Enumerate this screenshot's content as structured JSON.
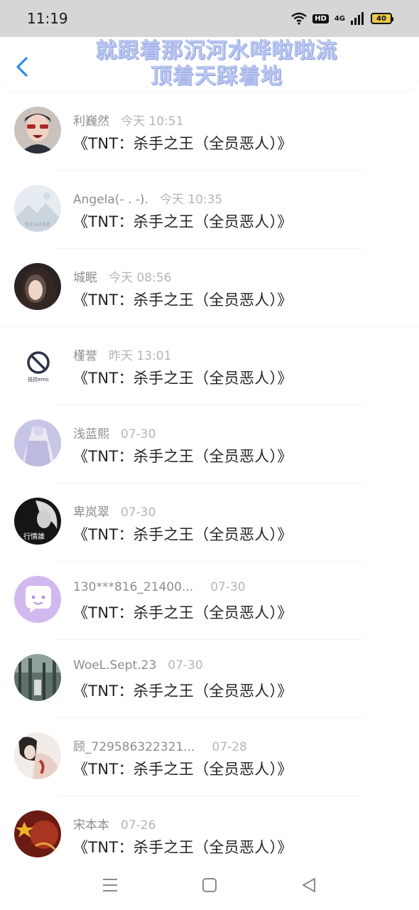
{
  "status_bar": {
    "time": "11:19",
    "hd": "HD",
    "network": "4G",
    "battery": "40",
    "icons": [
      "wifi-icon",
      "hd-icon",
      "signal-icon",
      "battery-icon"
    ]
  },
  "header": {
    "back_icon": "chevron-left-icon",
    "title_line1": "就跟着那沉河水哗啦啦流",
    "title_line2": "顶着天踩着地",
    "accent": "#2f8be6"
  },
  "messages": [
    {
      "name": "利巍然",
      "time": "今天 10:51",
      "text": "《TNT：杀手之王（全员恶人）》"
    },
    {
      "name": "Angela(- . -).",
      "time": "今天 10:35",
      "text": "《TNT：杀手之王（全员恶人）》"
    },
    {
      "name": "城眠",
      "time": "今天 08:56",
      "text": "《TNT：杀手之王（全员恶人）》"
    },
    {
      "name": "槿誉",
      "time": "昨天 13:01",
      "text": "《TNT：杀手之王（全员恶人）》"
    },
    {
      "name": "浅蓝熙",
      "time": "07-30",
      "text": "《TNT：杀手之王（全员恶人）》"
    },
    {
      "name": "卑岚翠",
      "time": "07-30",
      "text": "《TNT：杀手之王（全员恶人）》"
    },
    {
      "name": "130***816_21400...",
      "time": "07-30",
      "text": "《TNT：杀手之王（全员恶人）》"
    },
    {
      "name": "WoeL.Sept.23",
      "time": "07-30",
      "text": "《TNT：杀手之王（全员恶人）》"
    },
    {
      "name": "顾_729586322321...",
      "time": "07-28",
      "text": "《TNT：杀手之王（全员恶人）》"
    },
    {
      "name": "宋本本",
      "time": "07-26",
      "text": "《TNT：杀手之王（全员恶人）》"
    }
  ],
  "avatar_texts": {
    "a2": "你还无法查看",
    "a4": "抵抗emo",
    "a6": "行情誰"
  },
  "nav_bar": {
    "icons": [
      "menu-icon",
      "home-square-icon",
      "back-triangle-icon"
    ]
  }
}
